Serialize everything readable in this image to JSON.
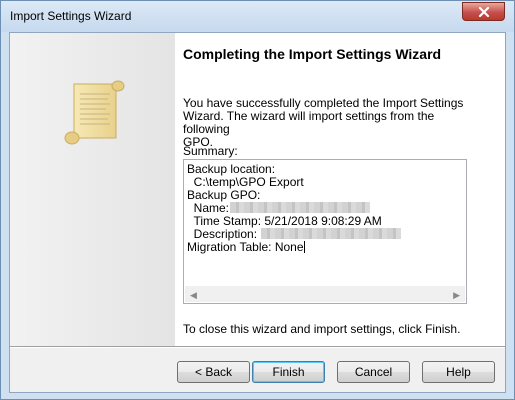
{
  "window": {
    "title": "Import Settings Wizard"
  },
  "icons": {
    "close": "close-icon",
    "wizard": "scroll-icon"
  },
  "main": {
    "heading": "Completing the Import Settings Wizard",
    "intro_lines": [
      "You have successfully completed the Import Settings",
      "Wizard. The wizard will import settings from the following",
      "GPO."
    ],
    "summary_label": "Summary:",
    "summary": {
      "backup_location_label": "Backup location:",
      "backup_location_value": "  C:\\temp\\GPO Export",
      "backup_gpo_label": "Backup GPO:",
      "name_label": "  Name:",
      "time_stamp": "  Time Stamp: 5/21/2018 9:08:29 AM",
      "description_label": "  Description:",
      "migration_table": "Migration Table: None"
    },
    "finish_note": "To close this wizard and import settings, click Finish."
  },
  "buttons": {
    "back": "< Back",
    "finish": "Finish",
    "cancel": "Cancel",
    "help": "Help"
  },
  "colors": {
    "frame": "#cfe0f1",
    "close_button": "#c75050",
    "default_button_border": "#3c7fb1"
  }
}
